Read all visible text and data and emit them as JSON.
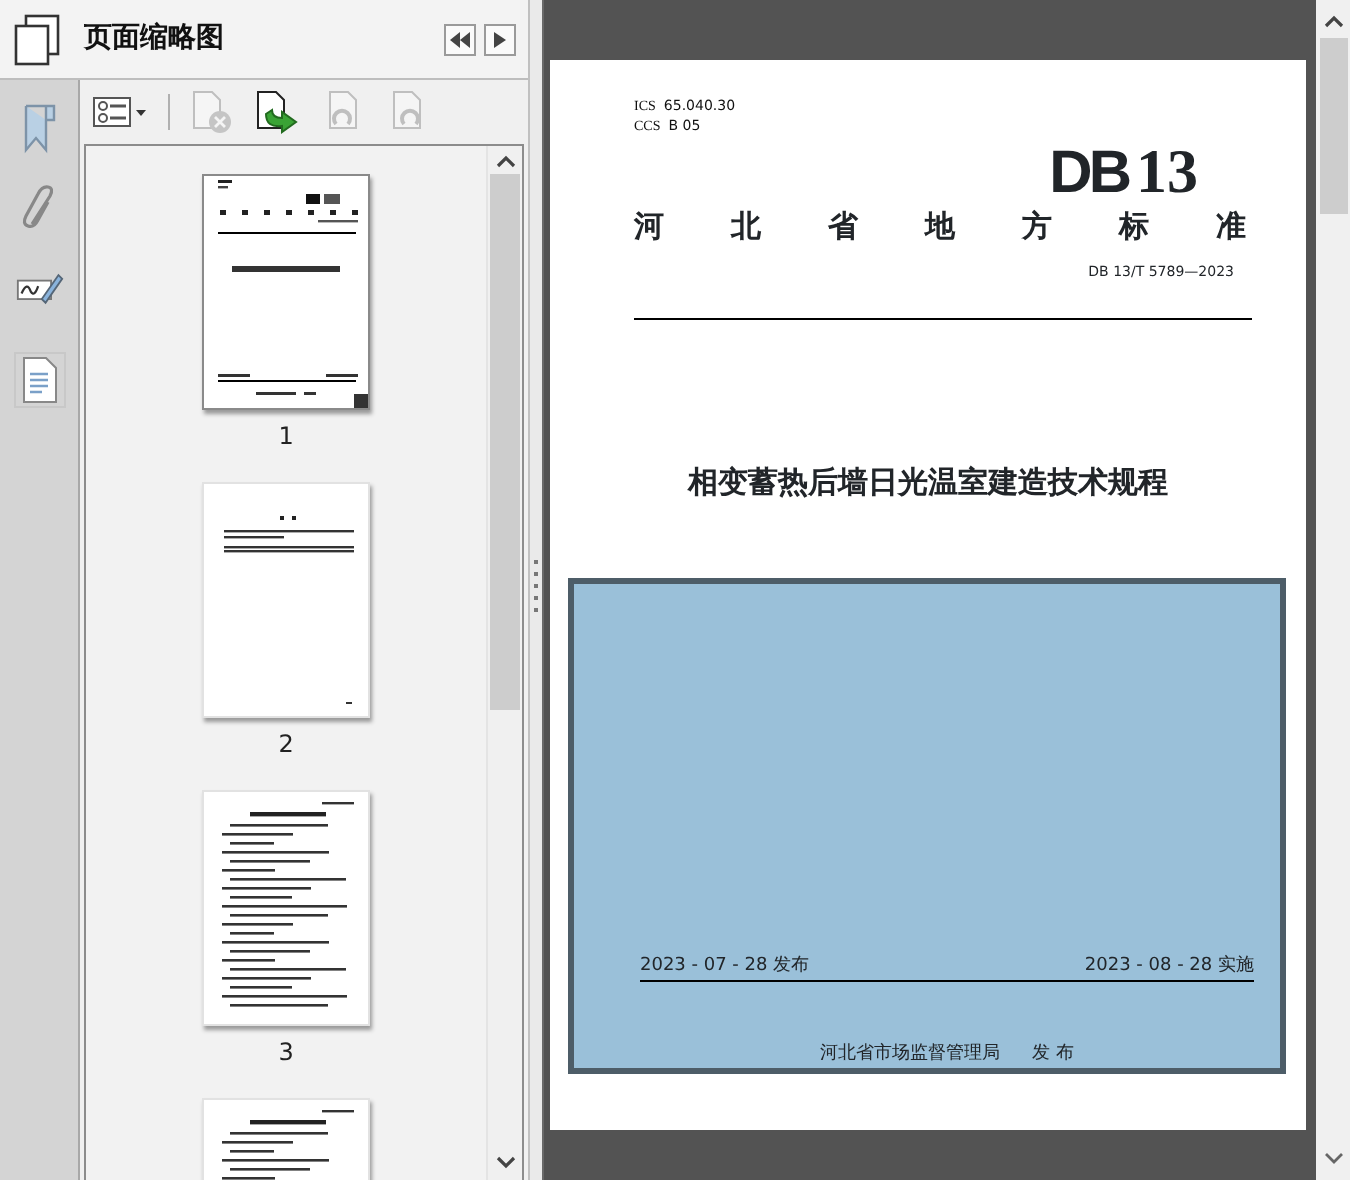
{
  "panel": {
    "title": "页面缩略图",
    "nav": [
      {
        "kind": "collapse"
      },
      {
        "kind": "expand"
      }
    ]
  },
  "rail": [
    {
      "kind": "bookmark",
      "selected": false
    },
    {
      "kind": "attachment",
      "selected": false
    },
    {
      "kind": "signature",
      "selected": false
    },
    {
      "kind": "pages",
      "selected": true
    }
  ],
  "toolbar": [
    {
      "kind": "options",
      "disabled": false
    },
    {
      "kind": "delete",
      "disabled": true
    },
    {
      "kind": "insert",
      "disabled": false
    },
    {
      "kind": "rotate_left",
      "disabled": true
    },
    {
      "kind": "rotate_right",
      "disabled": true
    }
  ],
  "thumbnails": [
    {
      "kind": "cover",
      "label": "1",
      "selected": true
    },
    {
      "kind": "foreword",
      "label": "2",
      "selected": false
    },
    {
      "kind": "text",
      "label": "3",
      "selected": false
    },
    {
      "kind": "text",
      "selected": false
    }
  ],
  "document": {
    "ics_label": "ICS",
    "ics": "65.040.30",
    "ccs_label": "CCS",
    "ccs": "B 05",
    "logo_mark": "DB",
    "logo_number": "13",
    "category": [
      "河",
      "北",
      "省",
      "地",
      "方",
      "标",
      "准"
    ],
    "code": "DB 13/T 5789—2023",
    "title": "相变蓄热后墙日光温室建造技术规程",
    "issue_date": "2023 - 07 - 28 发布",
    "effective_date": "2023 - 08 - 28 实施",
    "issuer": "河北省市场监督管理局",
    "issuer_action": "发 布"
  }
}
